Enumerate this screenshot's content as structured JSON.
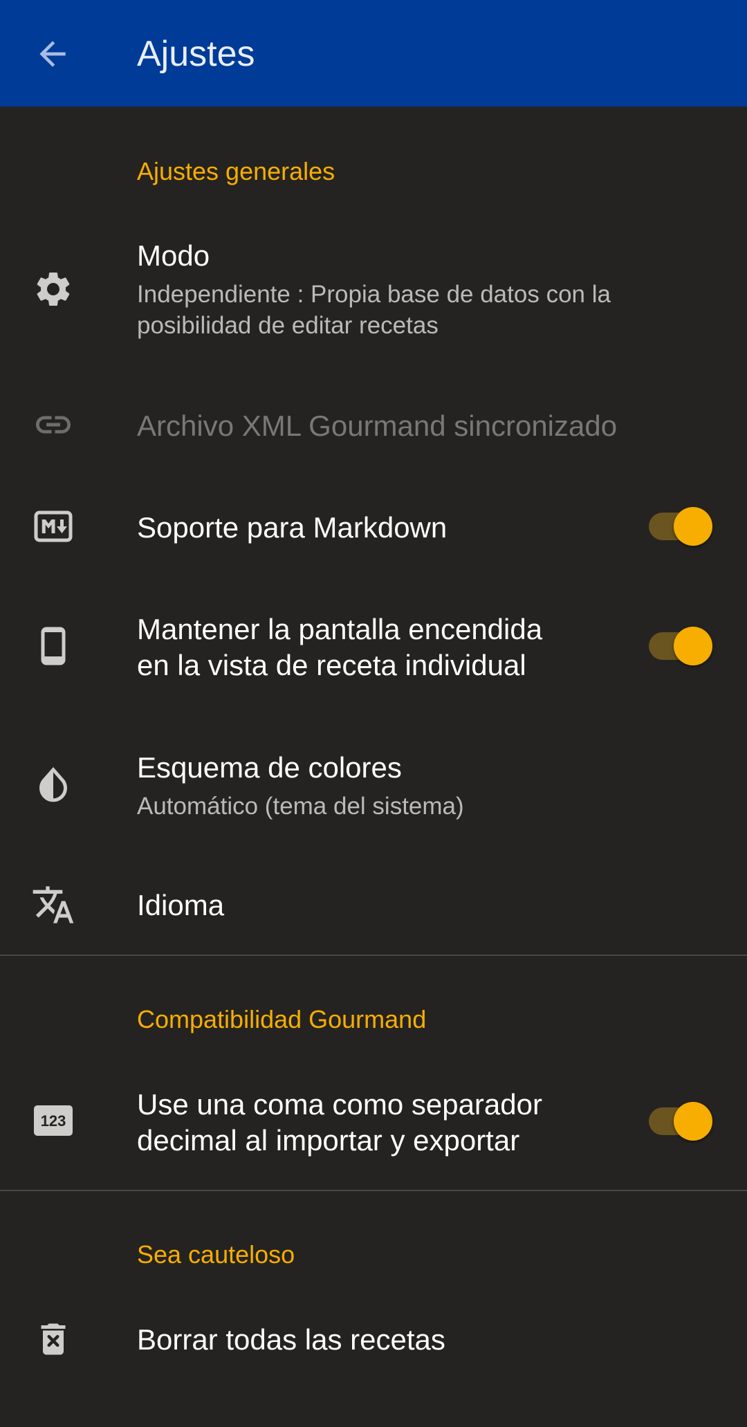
{
  "appbar": {
    "title": "Ajustes",
    "back_icon": "arrow-back-icon"
  },
  "sections": {
    "general": {
      "header": "Ajustes generales",
      "mode": {
        "icon": "gear-icon",
        "title": "Modo",
        "summary": "Independiente : Propia base de datos con la posibilidad de editar recetas"
      },
      "xml_sync": {
        "icon": "link-icon",
        "title": "Archivo XML Gourmand sincronizado",
        "enabled": false
      },
      "markdown": {
        "icon": "markdown-icon",
        "title": "Soporte para Markdown",
        "checked": true
      },
      "screen_on": {
        "icon": "phone-icon",
        "title_line1": "Mantener la pantalla encendida",
        "title_line2": "en la vista de receta individual",
        "checked": true
      },
      "color_scheme": {
        "icon": "contrast-drop-icon",
        "title": "Esquema de colores",
        "summary": "Automático (tema del sistema)"
      },
      "language": {
        "icon": "translate-icon",
        "title": "Idioma"
      }
    },
    "compat": {
      "header": "Compatibilidad Gourmand",
      "decimal_comma": {
        "icon": "numbers-123-icon",
        "title_line1": "Use una coma como separador",
        "title_line2": "decimal al importar y exportar",
        "checked": true
      }
    },
    "danger": {
      "header": "Sea cauteloso",
      "delete_all": {
        "icon": "trash-x-icon",
        "title": "Borrar todas las recetas"
      }
    }
  },
  "colors": {
    "appbar": "#003b97",
    "background": "#252321",
    "accent": "#f7ae00",
    "switch_track": "#6a5420"
  }
}
